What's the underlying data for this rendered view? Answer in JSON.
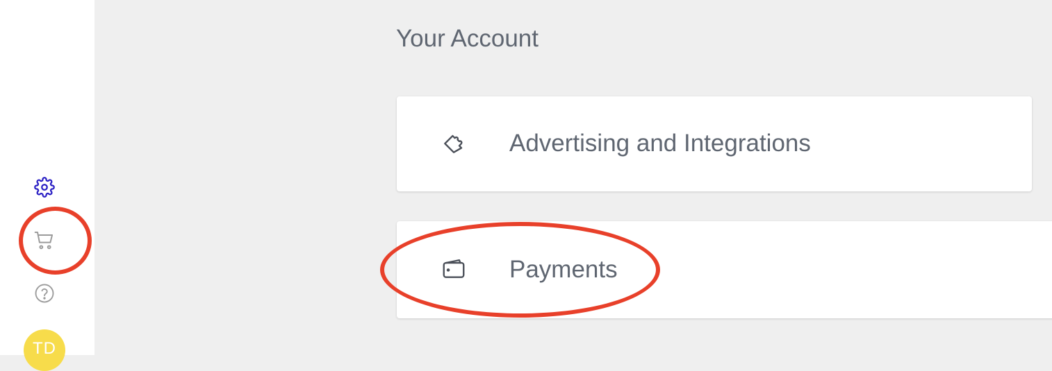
{
  "sidebar": {
    "icons": [
      "gear-icon",
      "cart-icon",
      "help-icon"
    ],
    "settings_color": "#2a1fc4",
    "icon_color": "#9b9b9b",
    "avatar": {
      "initials": "TD",
      "color": "#f7dc4b"
    }
  },
  "main": {
    "title": "Your Account",
    "cards": [
      {
        "icon": "puzzle-icon",
        "label": "Advertising and Integrations"
      },
      {
        "icon": "wallet-icon",
        "label": "Payments"
      }
    ]
  },
  "annotations": {
    "color": "#e8402a"
  }
}
